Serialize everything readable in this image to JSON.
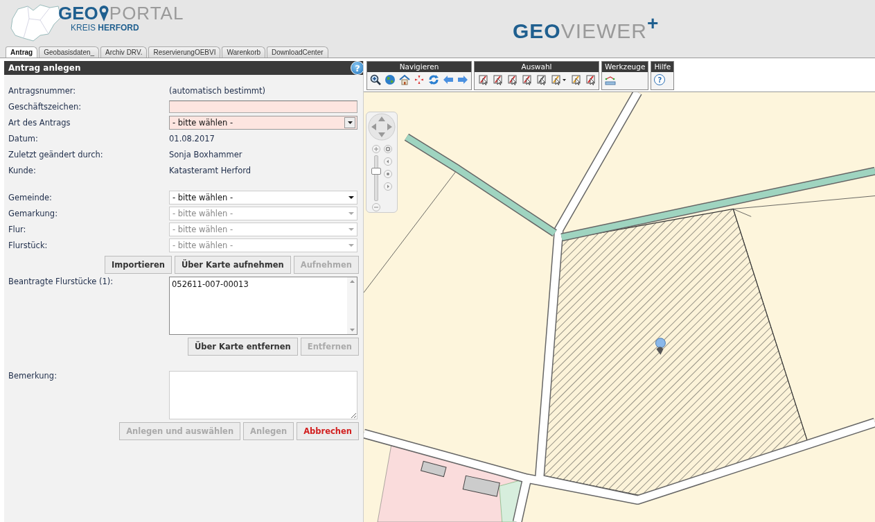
{
  "header": {
    "logo": {
      "geo": "GEO",
      "portal": "PORTAL",
      "region": "KREIS",
      "region_bold": "HERFORD"
    },
    "app_title": {
      "bold": "GEO",
      "light": "VIEWER",
      "plus": "+"
    }
  },
  "tabs": [
    {
      "label": "Antrag",
      "selected": true
    },
    {
      "label": "Geobasisdaten_",
      "selected": false
    },
    {
      "label": "Archiv DRV.",
      "selected": false
    },
    {
      "label": "ReservierungOEBVI",
      "selected": false
    },
    {
      "label": "Warenkorb",
      "selected": false
    },
    {
      "label": "DownloadCenter",
      "selected": false
    }
  ],
  "panel": {
    "title": "Antrag anlegen",
    "help_glyph": "?",
    "fields": [
      {
        "kind": "info",
        "label": "Antragsnummer:",
        "value": "(automatisch bestimmt)"
      },
      {
        "kind": "input",
        "label": "Geschäftszeichen:",
        "required": true
      },
      {
        "kind": "select",
        "label": "Art des Antrags",
        "value": "- bitte wählen -",
        "required": true,
        "disabled": false
      },
      {
        "kind": "info",
        "label": "Datum:",
        "value": "01.08.2017"
      },
      {
        "kind": "info",
        "label": "Zuletzt geändert durch:",
        "value": "Sonja Boxhammer"
      },
      {
        "kind": "info",
        "label": "Kunde:",
        "value": "Katasteramt Herford"
      }
    ],
    "parcel_fields": [
      {
        "label": "Gemeinde:",
        "value": "- bitte wählen -",
        "disabled": false
      },
      {
        "label": "Gemarkung:",
        "value": "- bitte wählen -",
        "disabled": true
      },
      {
        "label": "Flur:",
        "value": "- bitte wählen -",
        "disabled": true
      },
      {
        "label": "Flurstück:",
        "value": "- bitte wählen -",
        "disabled": true
      }
    ],
    "add_buttons": [
      {
        "label": "Importieren",
        "disabled": false
      },
      {
        "label": "Über Karte aufnehmen",
        "disabled": false
      },
      {
        "label": "Aufnehmen",
        "disabled": true
      }
    ],
    "parcel_list": {
      "label": "Beantragte Flurstücke (1):",
      "items": [
        "052611-007-00013"
      ]
    },
    "remove_buttons": [
      {
        "label": "Über Karte entfernen",
        "disabled": false
      },
      {
        "label": "Entfernen",
        "disabled": true
      }
    ],
    "remark": {
      "label": "Bemerkung:"
    },
    "action_buttons": [
      {
        "label": "Anlegen und auswählen",
        "disabled": true,
        "kind": "normal"
      },
      {
        "label": "Anlegen",
        "disabled": true,
        "kind": "normal"
      },
      {
        "label": "Abbrechen",
        "disabled": false,
        "kind": "cancel"
      }
    ]
  },
  "toolbar": [
    {
      "title": "Navigieren"
    },
    {
      "title": "Auswahl"
    },
    {
      "title": "Werkzeuge"
    },
    {
      "title": "Hilfe",
      "help_glyph": "?"
    }
  ],
  "map": {
    "zoom": {
      "level": 0.65
    }
  }
}
